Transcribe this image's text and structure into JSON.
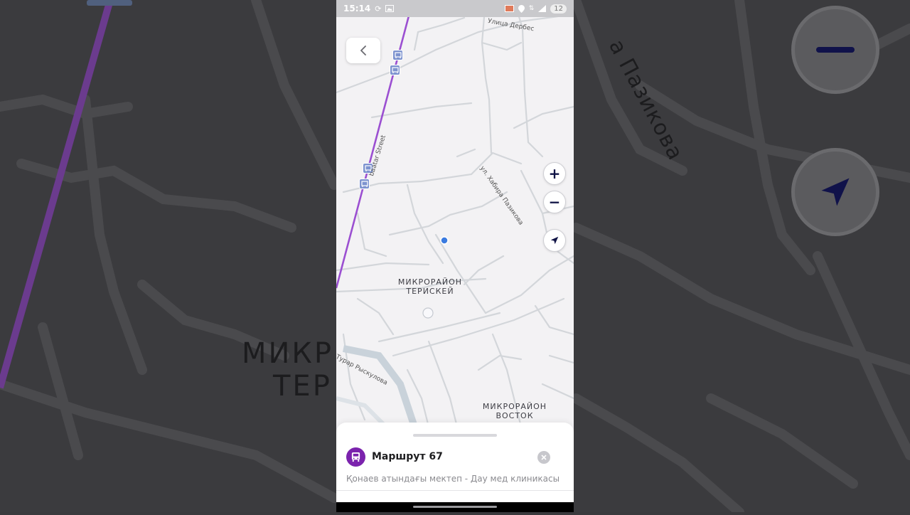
{
  "status_bar": {
    "time": "15:14",
    "battery": "12",
    "icons": [
      "sync-icon",
      "image-icon",
      "cast-icon",
      "location-icon",
      "network-icon",
      "signal-icon",
      "battery-icon"
    ]
  },
  "map": {
    "streets": {
      "derbes": "Улица Дербес",
      "pazikova": "ул. Хабира Пазикова",
      "batyr": "baatar Street",
      "ryskulov": "Турар Рыскулова"
    },
    "districts": {
      "teriskey_line1": "МИКРОРАЙОН",
      "teriskey_line2": "ТЕРИСКЕЙ",
      "vostok_line1": "МИКРОРАЙОН",
      "vostok_line2": "ВОСТОК"
    },
    "controls": {
      "zoom_in": "+",
      "zoom_out": "−"
    },
    "colors": {
      "route_line": "#9b4fd1",
      "user_location": "#3b7be0"
    }
  },
  "route_sheet": {
    "route_title": "Маршрут 67",
    "route_description": "Қонаев атындағы мектеп - Дау мед клиникасы"
  },
  "background": {
    "text_line1": "МИКР",
    "text_line2": "ТЕР",
    "street_label": "а Пазикова"
  }
}
